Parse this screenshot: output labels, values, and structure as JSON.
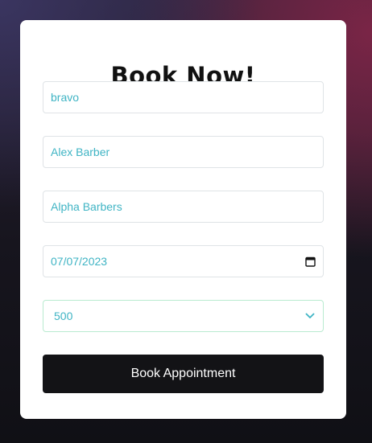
{
  "form": {
    "title": "Book Now!",
    "fields": [
      {
        "value": "bravo"
      },
      {
        "value": "Alex Barber"
      },
      {
        "value": "Alpha Barbers"
      },
      {
        "value": "07/07/2023"
      },
      {
        "value": "500"
      }
    ],
    "submit_label": "Book Appointment",
    "icons": {
      "date": "calendar-icon",
      "select": "chevron-down-icon"
    },
    "colors": {
      "field_text": "#3fb4c4",
      "button_bg": "#131316",
      "card_bg": "#ffffff"
    }
  }
}
